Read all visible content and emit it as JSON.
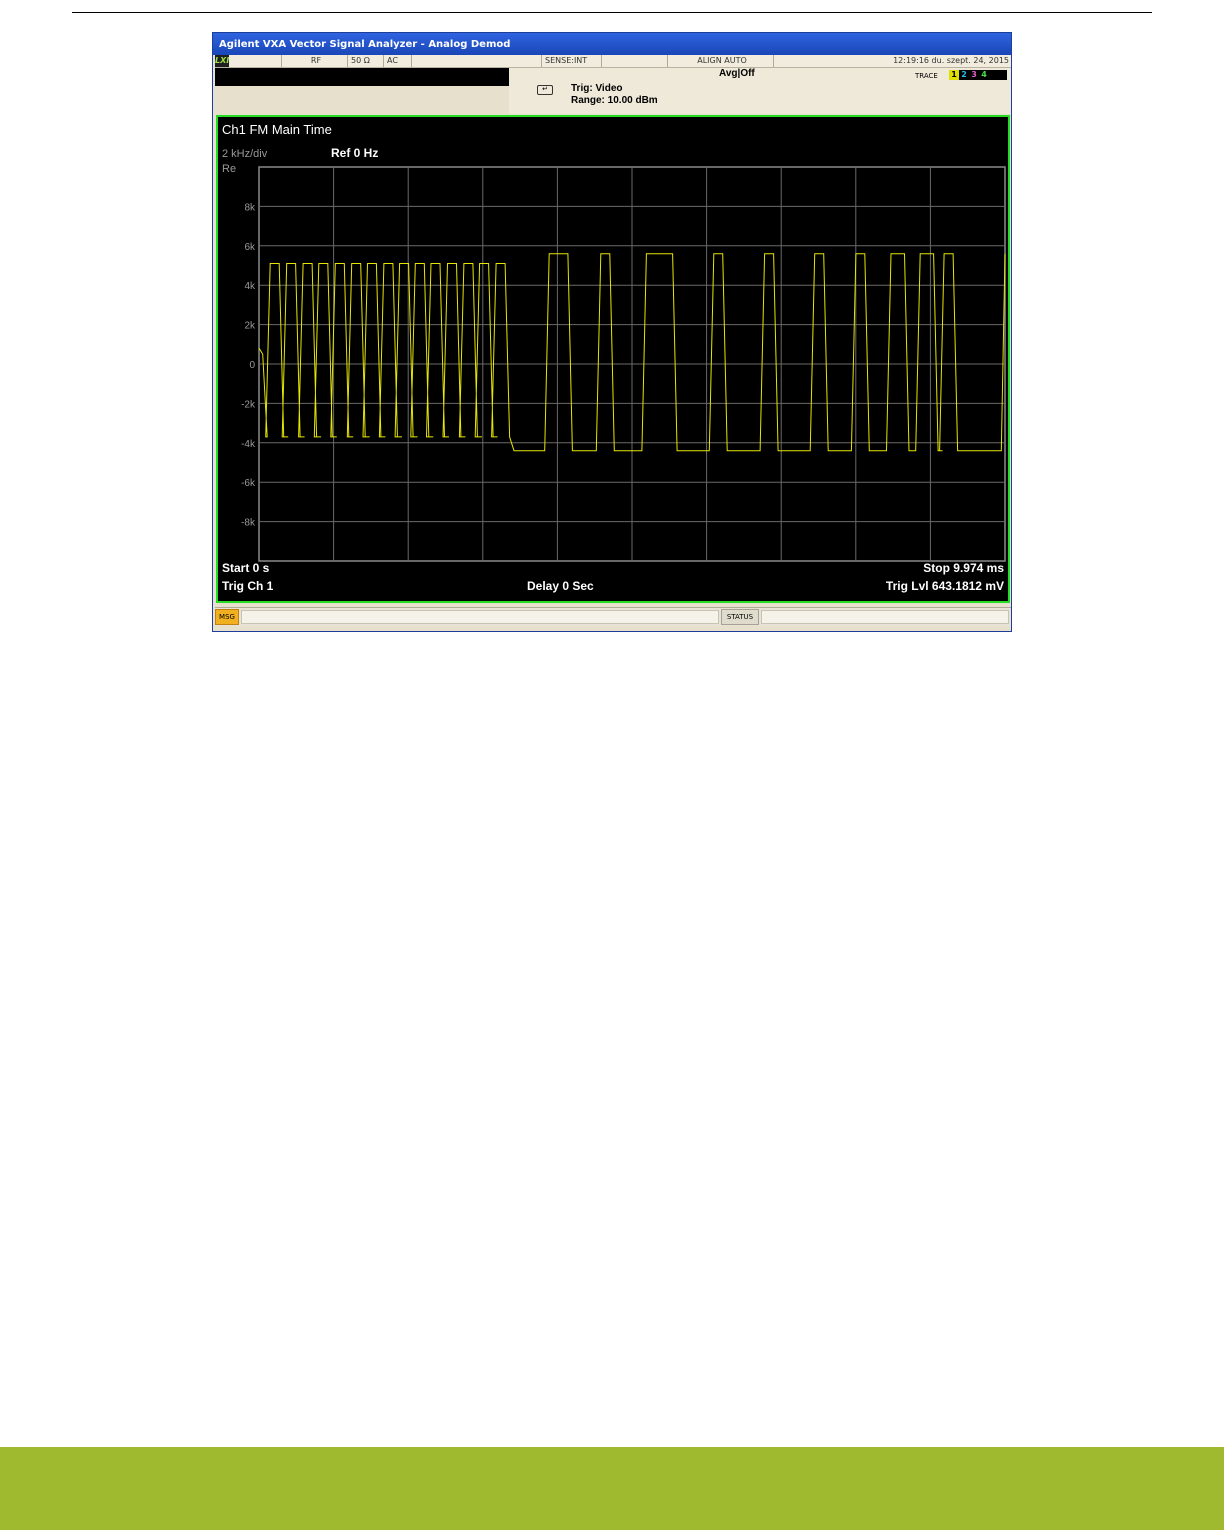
{
  "window": {
    "title": "Agilent VXA Vector Signal Analyzer - Analog Demod"
  },
  "status_top": {
    "logo": "LXI",
    "rf": "RF",
    "impedance": "50 Ω",
    "coupling": "AC",
    "sense": "SENSE:INT",
    "align": "ALIGN AUTO",
    "datetime": "12:19:16 du. szept. 24, 2015"
  },
  "info": {
    "avg": "Avg|Off",
    "trigger": "Trig: Video",
    "range": "Range: 10.00 dBm",
    "trace_label": "TRACE",
    "traces": [
      "1",
      "2",
      "3",
      "4"
    ]
  },
  "display": {
    "title": "Ch1 FM Main Time",
    "scale": "2 kHz/div",
    "ref": "Ref 0 Hz",
    "format": "Re",
    "start": "Start 0  s",
    "stop": "Stop 9.974 ms",
    "trig_ch": "Trig Ch 1",
    "delay": "Delay 0  Sec",
    "trig_lvl": "Trig Lvl 643.1812 mV"
  },
  "msgbar": {
    "msg": "MSG",
    "status": "STATUS"
  },
  "colors": {
    "trace": "#e6e600",
    "grid": "#6a6a6a",
    "display_border": "#22dd22",
    "footer_band": "#a0ba2f"
  },
  "chart_data": {
    "type": "line",
    "yticks": [
      "8k",
      "6k",
      "4k",
      "2k",
      "0",
      "-2k",
      "-4k",
      "-6k",
      "-8k"
    ],
    "ylim": [
      -10000,
      10000
    ],
    "xlim": [
      0,
      9.974
    ],
    "x_unit": "ms",
    "y_unit": "Hz",
    "x_divisions": 10,
    "y_divisions": 10,
    "pulses": [
      {
        "start": 0.15,
        "width": 0.12
      },
      {
        "start": 0.37,
        "width": 0.12
      },
      {
        "start": 0.59,
        "width": 0.12
      },
      {
        "start": 0.8,
        "width": 0.12
      },
      {
        "start": 1.02,
        "width": 0.12
      },
      {
        "start": 1.24,
        "width": 0.12
      },
      {
        "start": 1.45,
        "width": 0.12
      },
      {
        "start": 1.67,
        "width": 0.12
      },
      {
        "start": 1.88,
        "width": 0.12
      },
      {
        "start": 2.09,
        "width": 0.12
      },
      {
        "start": 2.3,
        "width": 0.12
      },
      {
        "start": 2.52,
        "width": 0.12
      },
      {
        "start": 2.74,
        "width": 0.12
      },
      {
        "start": 2.95,
        "width": 0.12
      },
      {
        "start": 3.17,
        "width": 0.12
      },
      {
        "start": 3.88,
        "width": 0.25
      },
      {
        "start": 4.57,
        "width": 0.12
      },
      {
        "start": 5.18,
        "width": 0.35
      },
      {
        "start": 6.08,
        "width": 0.12
      },
      {
        "start": 6.76,
        "width": 0.12
      },
      {
        "start": 7.43,
        "width": 0.12
      },
      {
        "start": 7.98,
        "width": 0.12
      },
      {
        "start": 8.45,
        "width": 0.18
      },
      {
        "start": 8.84,
        "width": 0.18
      },
      {
        "start": 9.16,
        "width": 0.12
      }
    ],
    "lows": [
      {
        "from": 0.0,
        "to": 3.4,
        "value": -3700
      },
      {
        "from": 3.4,
        "to": 5.0,
        "value": -4400
      },
      {
        "from": 5.0,
        "to": 6.0,
        "value": -4400
      },
      {
        "from": 6.0,
        "to": 9.974,
        "value": -4400
      }
    ],
    "highs": [
      {
        "from": 0.0,
        "to": 3.5,
        "value": 5100
      },
      {
        "from": 3.5,
        "to": 9.974,
        "value": 5600
      }
    ]
  }
}
